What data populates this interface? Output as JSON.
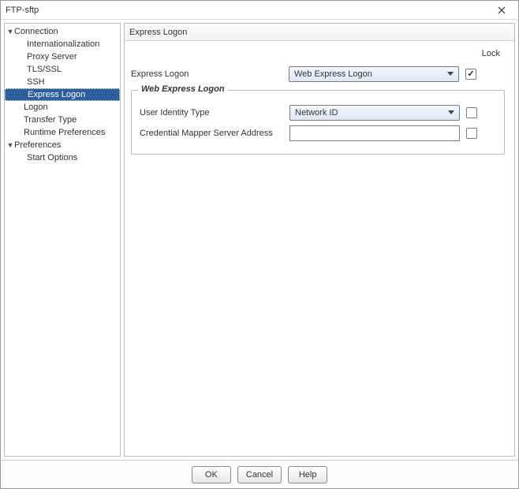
{
  "window": {
    "title": "FTP-sftp"
  },
  "sidebar": {
    "items": [
      {
        "label": "Connection",
        "level": 0,
        "expanded": true
      },
      {
        "label": "Internationalization",
        "level": 1
      },
      {
        "label": "Proxy Server",
        "level": 1
      },
      {
        "label": "TLS/SSL",
        "level": 1
      },
      {
        "label": "SSH",
        "level": 1
      },
      {
        "label": "Express Logon",
        "level": 1,
        "selected": true
      },
      {
        "label": "Logon",
        "level": 0
      },
      {
        "label": "Transfer Type",
        "level": 0
      },
      {
        "label": "Runtime Preferences",
        "level": 0
      },
      {
        "label": "Preferences",
        "level": 0,
        "expanded": true
      },
      {
        "label": "Start Options",
        "level": 1
      }
    ]
  },
  "content": {
    "header": "Express Logon",
    "lock_label": "Lock",
    "express_logon": {
      "label": "Express Logon",
      "value": "Web Express Logon",
      "locked": true
    },
    "group": {
      "legend": "Web Express Logon",
      "user_identity_type": {
        "label": "User Identity Type",
        "value": "Network ID",
        "locked": false
      },
      "credential_mapper": {
        "label": "Credential Mapper Server Address",
        "value": "",
        "locked": false
      }
    }
  },
  "buttons": {
    "ok": "OK",
    "cancel": "Cancel",
    "help": "Help"
  }
}
